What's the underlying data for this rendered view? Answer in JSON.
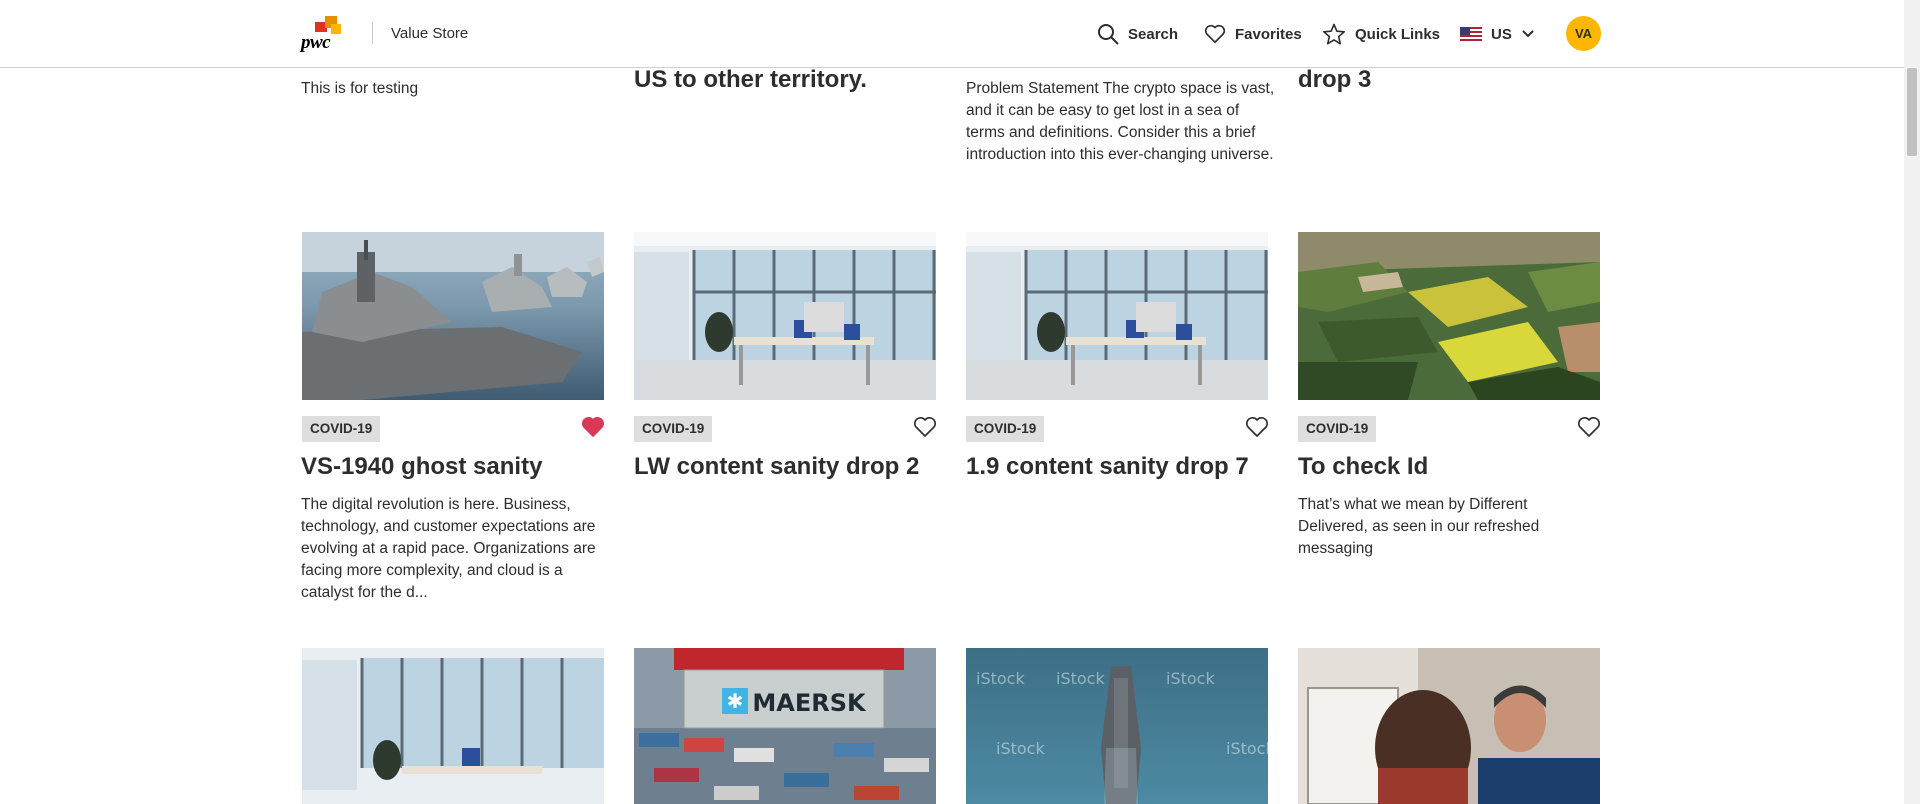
{
  "header": {
    "brand": "pwc",
    "store_name": "Value Store",
    "nav": {
      "search": "Search",
      "favorites": "Favorites",
      "quick_links": "Quick Links",
      "region": "US"
    },
    "avatar_initials": "VA"
  },
  "top_row": [
    {
      "description": "This is for testing"
    },
    {
      "title_tail": "US to other territory."
    },
    {
      "description": "Problem Statement The crypto space is vast, and it can be easy to get lost in a sea of terms and definitions. Consider this a brief introduction into this ever-changing universe."
    },
    {
      "title_tail": "drop 3"
    }
  ],
  "cards": [
    {
      "tag": "COVID-19",
      "title": "VS-1940 ghost sanity",
      "favorited": true,
      "image": "navy-ships-image",
      "description": "The digital revolution is here. Business, technology, and customer expectations are evolving at a rapid pace. Organizations are facing more complexity, and cloud is a catalyst for the d..."
    },
    {
      "tag": "COVID-19",
      "title": "LW content sanity drop 2",
      "favorited": false,
      "image": "office-image",
      "description": ""
    },
    {
      "tag": "COVID-19",
      "title": "1.9 content sanity drop 7",
      "favorited": false,
      "image": "office-image",
      "description": ""
    },
    {
      "tag": "COVID-19",
      "title": "To check Id",
      "favorited": false,
      "image": "aerial-fields-image",
      "description": "That’s what we mean by Different Delivered, as seen in our refreshed messaging"
    }
  ],
  "bottom_row": [
    {
      "image": "office-image"
    },
    {
      "image": "maersk-containers-image",
      "image_text": "MAERSK"
    },
    {
      "image": "aircraft-carrier-image",
      "watermark": "iStock"
    },
    {
      "image": "meeting-people-image"
    }
  ],
  "colors": {
    "heart_active": "#d93954",
    "accent_yellow": "#ffb600",
    "tag_bg": "#dedede"
  }
}
